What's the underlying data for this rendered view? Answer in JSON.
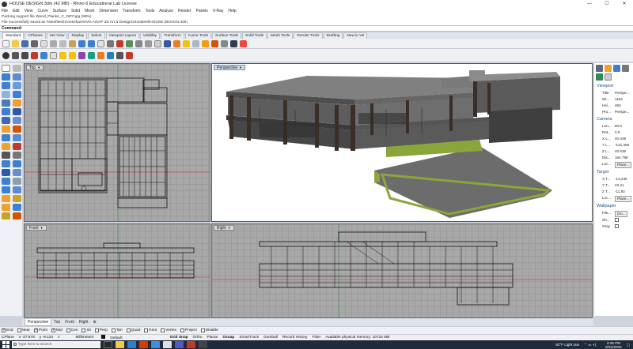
{
  "window": {
    "title": "HOUSE DESIGN.3dm (42 MB) - Rhino 6 Educational Lab License",
    "controls": [
      "—",
      "☐",
      "✕"
    ]
  },
  "menu": [
    "File",
    "Edit",
    "View",
    "Curve",
    "Surface",
    "Solid",
    "Mesh",
    "Dimension",
    "Transform",
    "Tools",
    "Analyze",
    "Render",
    "Panels",
    "V-Ray",
    "Help"
  ],
  "history": [
    "Packing support file Wood_Planks_C_DIFF.jpg (99%)",
    "File successfully saved as \\\\stsefiles01\\nesshares\\Vis Art\\AP 3D Art & Design\\24Gabriel\\HOUSE DESIGN.3dm."
  ],
  "command": {
    "label": "Command:"
  },
  "toolbar_tabs": [
    "Standard",
    "CPlanes",
    "Set View",
    "Display",
    "Select",
    "Viewport Layout",
    "Visibility",
    "Transform",
    "Curve Tools",
    "Surface Tools",
    "Solid Tools",
    "Mesh Tools",
    "Render Tools",
    "Drafting",
    "New in V6"
  ],
  "active_toolbar_tab": "Standard",
  "viewports": {
    "top": {
      "label": "Top"
    },
    "perspective": {
      "label": "Perspective"
    },
    "front": {
      "label": "Front"
    },
    "right": {
      "label": "Right"
    }
  },
  "properties": {
    "viewport_section": "Viewport",
    "viewport_rows": [
      {
        "k": "Title",
        "v": "Perspe..."
      },
      {
        "k": "Wi...",
        "v": "1152"
      },
      {
        "k": "Hei...",
        "v": "493"
      },
      {
        "k": "Pro...",
        "v": "Perspe..."
      }
    ],
    "camera_section": "Camera",
    "camera_rows": [
      {
        "k": "Len...",
        "v": "50.0"
      },
      {
        "k": "Rot...",
        "v": "0.0"
      },
      {
        "k": "X L...",
        "v": "40.439"
      },
      {
        "k": "Y L...",
        "v": "-121.468"
      },
      {
        "k": "Z L...",
        "v": "40.635"
      },
      {
        "k": "Dis...",
        "v": "164.798"
      },
      {
        "k": "Loc...",
        "v": "Place..."
      }
    ],
    "target_section": "Target",
    "target_rows": [
      {
        "k": "X T...",
        "v": "-13.236"
      },
      {
        "k": "Y T...",
        "v": "23.21"
      },
      {
        "k": "Z T...",
        "v": "-11.93"
      },
      {
        "k": "Loc...",
        "v": "Place..."
      }
    ],
    "wallpaper_section": "Wallpaper",
    "wallpaper_rows": [
      {
        "k": "File...",
        "v": "(no..."
      },
      {
        "k": "Sh...",
        "v": ""
      },
      {
        "k": "Gray",
        "v": ""
      }
    ]
  },
  "view_tabs": [
    "Perspective",
    "Top",
    "Front",
    "Right",
    "⊕"
  ],
  "active_view_tab": "Perspective",
  "osnaps": [
    {
      "label": "End",
      "on": true
    },
    {
      "label": "Near",
      "on": false
    },
    {
      "label": "Point",
      "on": true
    },
    {
      "label": "Mid",
      "on": true
    },
    {
      "label": "Cen",
      "on": false
    },
    {
      "label": "Int",
      "on": false
    },
    {
      "label": "Perp",
      "on": false
    },
    {
      "label": "Tan",
      "on": false
    },
    {
      "label": "Quad",
      "on": false
    },
    {
      "label": "Knot",
      "on": false
    },
    {
      "label": "Vertex",
      "on": false
    },
    {
      "label": "Project",
      "on": false
    },
    {
      "label": "Disable",
      "on": false
    }
  ],
  "status": {
    "cplane": "CPlane",
    "x": "x -27.678",
    "y": "y -9.124",
    "z": "z",
    "units": "Millimeters",
    "layer": "Default",
    "items": [
      "Grid Snap",
      "Ortho",
      "Planar",
      "Osnap",
      "SmartTrack",
      "Gumball",
      "Record History",
      "Filter",
      "Available physical memory: 10722 MB"
    ]
  },
  "taskbar": {
    "search_placeholder": "Type here to search",
    "weather": "82°F  Light rain",
    "time": "3:36 PM",
    "date": "5/31/2022"
  },
  "colors": {
    "accent": "#1e4f8f",
    "viewport_bg": "#a8a8a8",
    "grass": "#8aa63a"
  }
}
